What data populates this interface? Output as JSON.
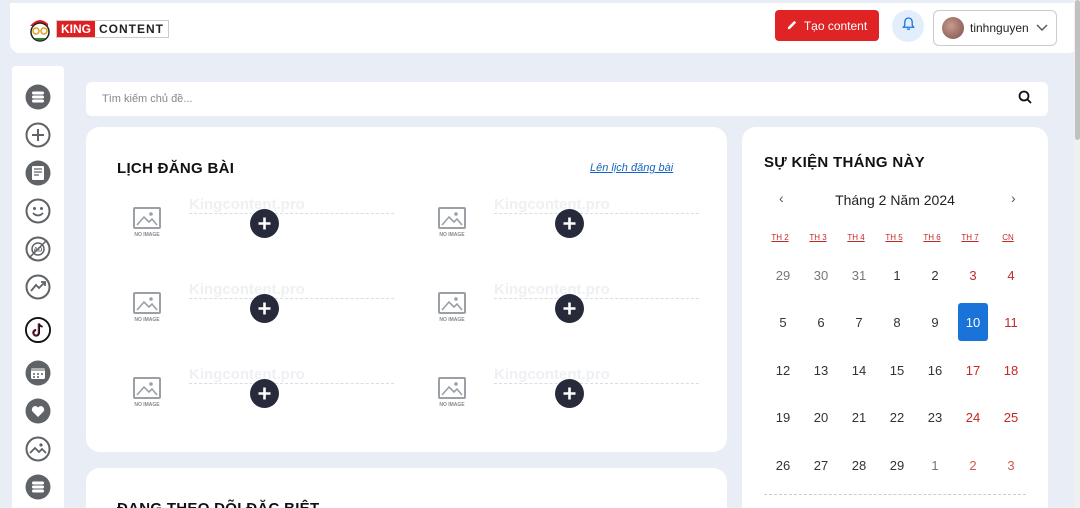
{
  "header": {
    "logo_king": "KING",
    "logo_content": "CONTENT",
    "create_label": "Tạo content",
    "username": "tinhnguyen"
  },
  "sidebar": {
    "icons": [
      "menu-icon",
      "add-circle-icon",
      "document-icon",
      "smiley-icon",
      "ad-icon",
      "trend-icon",
      "tiktok-icon",
      "calendar-icon",
      "heart-icon",
      "picture-icon",
      "menu-icon"
    ]
  },
  "search": {
    "placeholder": "Tìm kiếm chủ đề..."
  },
  "schedule": {
    "title": "LỊCH ĐĂNG BÀI",
    "link": "Lên lịch đăng bài",
    "watermark": "Kingcontent.pro",
    "noimage_caption": "NO IMAGE",
    "slot_count": 6
  },
  "follow": {
    "title": "ĐANG THEO DÕI ĐẶC BIỆT"
  },
  "calendar": {
    "title": "SỰ KIỆN THÁNG NÀY",
    "month_label": "Tháng 2 Năm 2024",
    "prev": "‹",
    "next": "›",
    "weekdays": [
      "TH 2",
      "TH 3",
      "TH 4",
      "TH 5",
      "TH 6",
      "TH 7",
      "CN"
    ],
    "weeks": [
      [
        "29",
        "30",
        "31",
        "1",
        "2",
        "3",
        "4"
      ],
      [
        "5",
        "6",
        "7",
        "8",
        "9",
        "10",
        "11"
      ],
      [
        "12",
        "13",
        "14",
        "15",
        "16",
        "17",
        "18"
      ],
      [
        "19",
        "20",
        "21",
        "22",
        "23",
        "24",
        "25"
      ],
      [
        "26",
        "27",
        "28",
        "29",
        "1",
        "2",
        "3"
      ]
    ],
    "other_month": [
      [
        0,
        0
      ],
      [
        0,
        1
      ],
      [
        0,
        2
      ],
      [
        4,
        4
      ],
      [
        4,
        5
      ],
      [
        4,
        6
      ]
    ],
    "today": "10",
    "accent": "#1a73d9"
  }
}
